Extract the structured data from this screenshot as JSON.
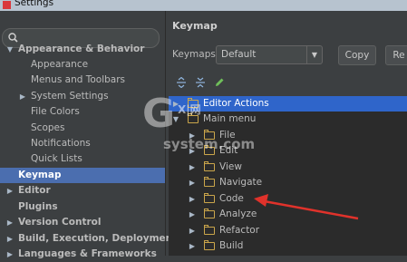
{
  "window": {
    "title": "Settings"
  },
  "search": {
    "placeholder": ""
  },
  "sidebar": {
    "items": [
      {
        "label": "Appearance & Behavior",
        "arrow": "▼",
        "bold": true
      },
      {
        "label": "Appearance"
      },
      {
        "label": "Menus and Toolbars"
      },
      {
        "label": "System Settings",
        "arrow": "▶"
      },
      {
        "label": "File Colors"
      },
      {
        "label": "Scopes"
      },
      {
        "label": "Notifications"
      },
      {
        "label": "Quick Lists"
      },
      {
        "label": "Keymap",
        "selected": true,
        "bold": true
      },
      {
        "label": "Editor",
        "arrow": "▶",
        "bold": true
      },
      {
        "label": "Plugins",
        "bold": true
      },
      {
        "label": "Version Control",
        "arrow": "▶",
        "bold": true
      },
      {
        "label": "Build, Execution, Deployment",
        "arrow": "▶",
        "bold": true
      },
      {
        "label": "Languages & Frameworks",
        "arrow": "▶",
        "bold": true
      }
    ]
  },
  "keymap": {
    "title": "Keymap",
    "keymaps_label": "Keymaps:",
    "selected_keymap": "Default",
    "copy_label": "Copy",
    "reset_label": "Re"
  },
  "tree": {
    "rows": [
      {
        "label": "Editor Actions",
        "arrow": "▶",
        "selected": true
      },
      {
        "label": "Main menu",
        "arrow": "▼"
      },
      {
        "label": "File",
        "arrow": "▶"
      },
      {
        "label": "Edit",
        "arrow": "▶"
      },
      {
        "label": "View",
        "arrow": "▶"
      },
      {
        "label": "Navigate",
        "arrow": "▶"
      },
      {
        "label": "Code",
        "arrow": "▶"
      },
      {
        "label": "Analyze",
        "arrow": "▶"
      },
      {
        "label": "Refactor",
        "arrow": "▶"
      },
      {
        "label": "Build",
        "arrow": "▶"
      }
    ]
  },
  "watermark": {
    "big": "G",
    "mark": "X|网",
    "site": "system.com"
  },
  "colors": {
    "accent": "#4b6eaf",
    "tree_selected": "#2f65ca",
    "annotation": "#e0322b"
  }
}
